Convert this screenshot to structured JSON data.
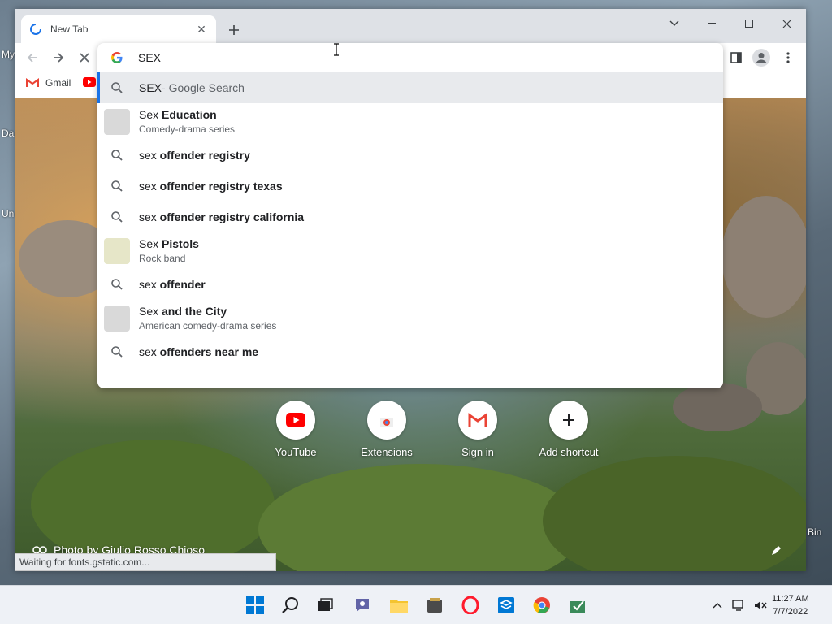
{
  "desktop": {
    "fragments": [
      "My",
      "Da",
      "Un",
      "Bin"
    ]
  },
  "browser": {
    "tab": {
      "title": "New Tab"
    },
    "omnibox": {
      "query": "SEX",
      "suggestions": [
        {
          "type": "search",
          "prefix": "SEX",
          "bold": "",
          "suffix": " - Google Search",
          "selected": true
        },
        {
          "type": "entity",
          "prefix": "Sex",
          "bold": " Education",
          "subtitle": "Comedy-drama series",
          "thumb_color": "#d9d9d9"
        },
        {
          "type": "search",
          "prefix": "sex",
          "bold": " offender registry"
        },
        {
          "type": "search",
          "prefix": "sex",
          "bold": " offender registry texas"
        },
        {
          "type": "search",
          "prefix": "sex",
          "bold": " offender registry california"
        },
        {
          "type": "entity",
          "prefix": "Sex",
          "bold": " Pistols",
          "subtitle": "Rock band",
          "thumb_color": "#e6e6c8"
        },
        {
          "type": "search",
          "prefix": "sex",
          "bold": " offender"
        },
        {
          "type": "entity",
          "prefix": "Sex",
          "bold": " and the City",
          "subtitle": "American comedy-drama series",
          "thumb_color": "#d9d9d9"
        },
        {
          "type": "search",
          "prefix": "sex",
          "bold": " offenders near me"
        }
      ]
    },
    "bookmarks": {
      "gmail": "Gmail"
    },
    "shortcuts": [
      {
        "label": "YouTube",
        "icon": "youtube-icon"
      },
      {
        "label": "Extensions",
        "icon": "chrome-web-store-icon"
      },
      {
        "label": "Sign in",
        "icon": "gmail-icon"
      },
      {
        "label": "Add shortcut",
        "icon": "plus-icon"
      }
    ],
    "photo_credit": "Photo by Giulio Rosso Chioso",
    "status": "Waiting for fonts.gstatic.com..."
  },
  "taskbar": {
    "time": "11:27 AM",
    "date": "7/7/2022"
  },
  "colors": {
    "accent": "#1a73e8",
    "selected_row": "#e8eaed",
    "taskbar": "#eef1f6"
  }
}
